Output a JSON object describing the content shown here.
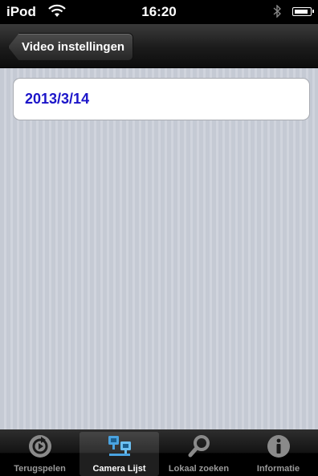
{
  "status_bar": {
    "carrier": "iPod",
    "time": "16:20"
  },
  "nav_bar": {
    "back_label": "Video instellingen"
  },
  "content": {
    "date": "2013/3/14"
  },
  "tab_bar": {
    "tabs": [
      {
        "label": "Terugspelen",
        "icon": "playback-icon",
        "selected": false
      },
      {
        "label": "Camera Lijst",
        "icon": "camera-list-icon",
        "selected": true
      },
      {
        "label": "Lokaal zoeken",
        "icon": "search-icon",
        "selected": false
      },
      {
        "label": "Informatie",
        "icon": "info-icon",
        "selected": false
      }
    ]
  },
  "colors": {
    "date_text": "#1c15c9",
    "tab_selected_icon": "#4aa3e0"
  }
}
